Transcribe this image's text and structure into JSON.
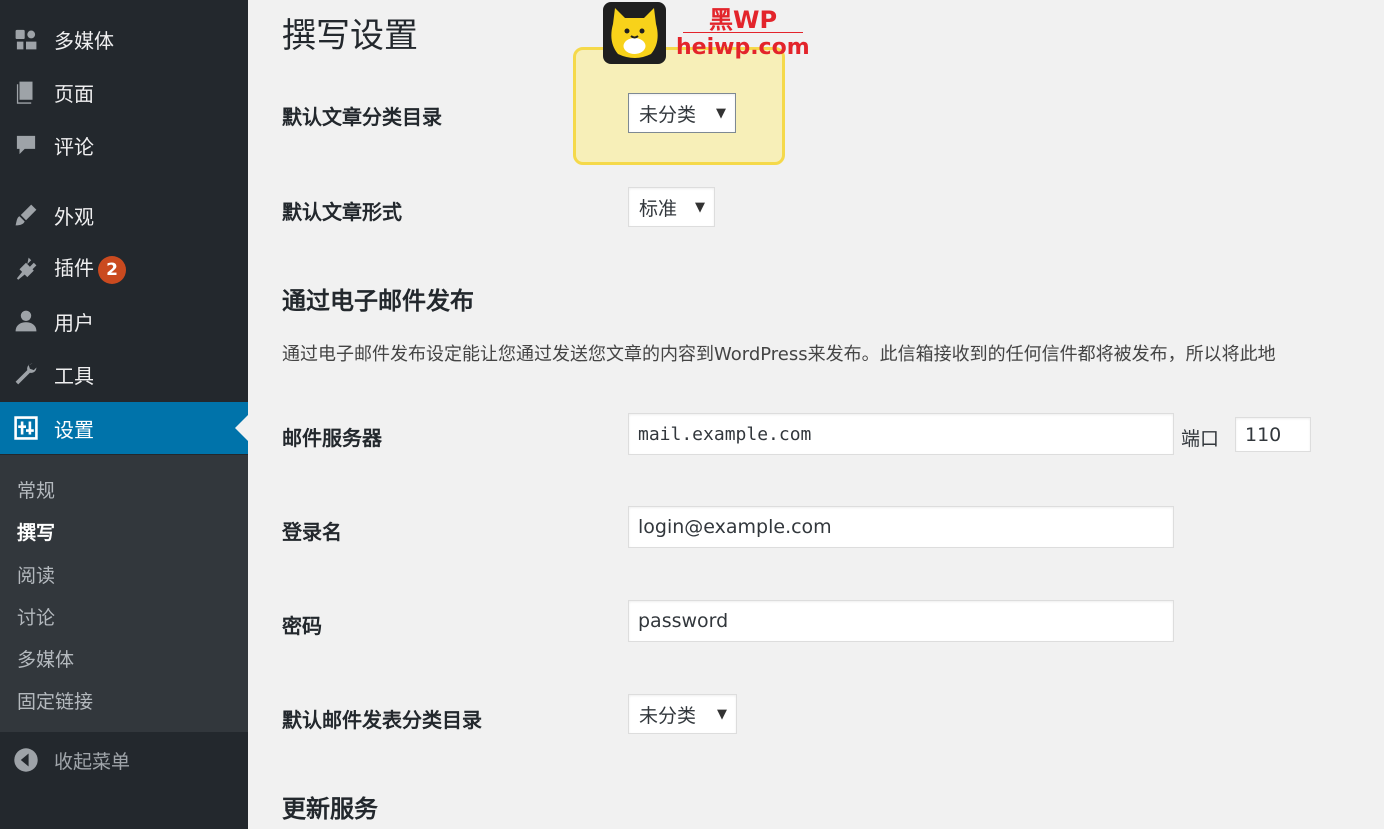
{
  "sidebar": {
    "items": [
      {
        "id": "media",
        "label": "多媒体",
        "icon": "media-icon"
      },
      {
        "id": "pages",
        "label": "页面",
        "icon": "page-icon"
      },
      {
        "id": "comments",
        "label": "评论",
        "icon": "comment-icon"
      },
      {
        "id": "appearance",
        "label": "外观",
        "icon": "paintbrush-icon"
      },
      {
        "id": "plugins",
        "label": "插件",
        "icon": "plugin-icon",
        "badge": "2"
      },
      {
        "id": "users",
        "label": "用户",
        "icon": "user-icon"
      },
      {
        "id": "tools",
        "label": "工具",
        "icon": "wrench-icon"
      },
      {
        "id": "settings",
        "label": "设置",
        "icon": "settings-icon",
        "active": true
      }
    ],
    "submenu": [
      "常规",
      "撰写",
      "阅读",
      "讨论",
      "多媒体",
      "固定链接"
    ],
    "submenu_current": "撰写",
    "collapse_label": "收起菜单"
  },
  "page": {
    "title": "撰写设置",
    "default_category": {
      "label": "默认文章分类目录",
      "value": "未分类"
    },
    "default_format": {
      "label": "默认文章形式",
      "value": "标准"
    },
    "email_section": {
      "title": "通过电子邮件发布",
      "description": "通过电子邮件发布设定能让您通过发送您文章的内容到WordPress来发布。此信箱接收到的任何信件都将被发布，所以将此地"
    },
    "mail_server": {
      "label": "邮件服务器",
      "value": "mail.example.com",
      "port_label": "端口",
      "port_value": "110"
    },
    "login": {
      "label": "登录名",
      "value": "login@example.com"
    },
    "password": {
      "label": "密码",
      "value": "password"
    },
    "email_category": {
      "label": "默认邮件发表分类目录",
      "value": "未分类"
    },
    "update_section": {
      "title": "更新服务"
    }
  },
  "watermark": {
    "brand_top": "黑WP",
    "brand_bottom": "heiwp.com"
  },
  "colors": {
    "sidebar_bg": "#23282d",
    "active_bg": "#0073aa",
    "badge": "#ca4a1f",
    "highlight": "#f7efb8"
  }
}
